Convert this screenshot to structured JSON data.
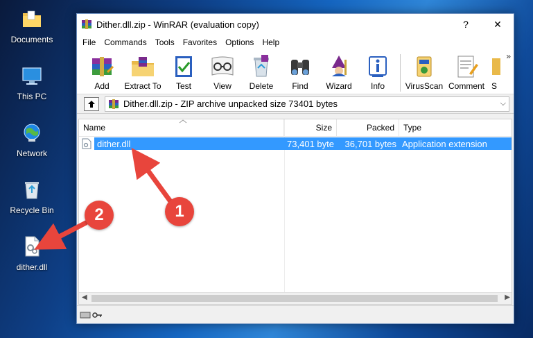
{
  "desktop": {
    "icons": [
      {
        "label": "Documents"
      },
      {
        "label": "This PC"
      },
      {
        "label": "Network"
      },
      {
        "label": "Recycle Bin"
      },
      {
        "label": "dither.dll"
      }
    ]
  },
  "window": {
    "title": "Dither.dll.zip - WinRAR (evaluation copy)",
    "help_button": "?",
    "close_button": "✕",
    "menu": [
      "File",
      "Commands",
      "Tools",
      "Favorites",
      "Options",
      "Help"
    ],
    "toolbar": [
      "Add",
      "Extract To",
      "Test",
      "View",
      "Delete",
      "Find",
      "Wizard",
      "Info",
      "VirusScan",
      "Comment",
      "S"
    ],
    "toolbar_more": "»",
    "address": "Dither.dll.zip - ZIP archive unpacked size 73401 bytes",
    "columns": {
      "name": "Name",
      "size": "Size",
      "packed": "Packed",
      "type": "Type"
    },
    "files": [
      {
        "name": "dither.dll",
        "size": "73,401 byte",
        "packed": "36,701 bytes",
        "type": "Application extension"
      }
    ]
  },
  "annotations": {
    "badge1": "1",
    "badge2": "2",
    "color": "#e8453c"
  },
  "colors": {
    "selection": "#3399ff",
    "desktop_blue": "#1565c0"
  }
}
